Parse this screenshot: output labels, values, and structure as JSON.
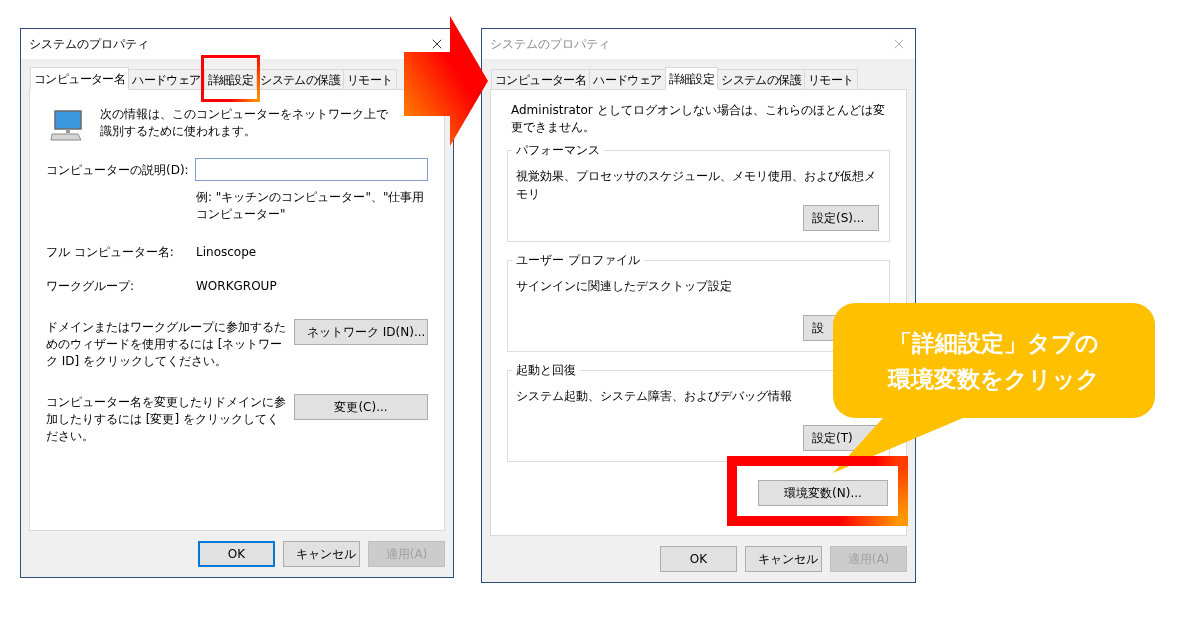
{
  "dialogs": [
    {
      "kind": "computer_name",
      "title": "システムのプロパティ",
      "active": true,
      "tabs": [
        {
          "label": "コンピューター名",
          "selected": true,
          "highlighted": false
        },
        {
          "label": "ハードウェア",
          "selected": false,
          "highlighted": false
        },
        {
          "label": "詳細設定",
          "selected": false,
          "highlighted": true
        },
        {
          "label": "システムの保護",
          "selected": false,
          "highlighted": false
        },
        {
          "label": "リモート",
          "selected": false,
          "highlighted": false
        }
      ],
      "intro": "次の情報は、このコンピューターをネットワーク上で識別するために使われます。",
      "description_label": "コンピューターの説明(D):",
      "example": "例: \"キッチンのコンピューター\"、\"仕事用コンピューター\"",
      "fields": [
        {
          "label": "フル コンピューター名:",
          "value": "Linoscope"
        },
        {
          "label": "ワークグループ:",
          "value": "WORKGROUP"
        }
      ],
      "actions": [
        {
          "text": "ドメインまたはワークグループに参加するためのウィザードを使用するには [ネットワーク ID] をクリックしてください。",
          "button": "ネットワーク ID(N)..."
        },
        {
          "text": "コンピューター名を変更したりドメインに参加したりするには [変更] をクリックしてください。",
          "button": "変更(C)..."
        }
      ],
      "buttons": [
        {
          "label": "OK",
          "focused": true,
          "disabled": false
        },
        {
          "label": "キャンセル",
          "focused": false,
          "disabled": false
        },
        {
          "label": "適用(A)",
          "focused": false,
          "disabled": true
        }
      ]
    },
    {
      "kind": "advanced",
      "title": "システムのプロパティ",
      "active": false,
      "tabs": [
        {
          "label": "コンピューター名",
          "selected": false,
          "highlighted": false
        },
        {
          "label": "ハードウェア",
          "selected": false,
          "highlighted": false
        },
        {
          "label": "詳細設定",
          "selected": true,
          "highlighted": false
        },
        {
          "label": "システムの保護",
          "selected": false,
          "highlighted": false
        },
        {
          "label": "リモート",
          "selected": false,
          "highlighted": false
        }
      ],
      "note": "Administrator としてログオンしない場合は、これらのほとんどは変更できません。",
      "groups": [
        {
          "title": "パフォーマンス",
          "description": "視覚効果、プロセッサのスケジュール、メモリ使用、および仮想メモリ",
          "button": "設定(S)..."
        },
        {
          "title": "ユーザー プロファイル",
          "description": "サインインに関連したデスクトップ設定",
          "button": "設"
        },
        {
          "title": "起動と回復",
          "description": "システム起動、システム障害、およびデバッグ情報",
          "button": "設定(T)"
        }
      ],
      "env_button": {
        "label": "環境変数(N)...",
        "highlighted": true
      },
      "buttons": [
        {
          "label": "OK",
          "focused": false,
          "disabled": false
        },
        {
          "label": "キャンセル",
          "focused": false,
          "disabled": false
        },
        {
          "label": "適用(A)",
          "focused": false,
          "disabled": true
        }
      ]
    }
  ],
  "callout": {
    "lines": [
      "「詳細設定」タブの",
      "環境変数をクリック"
    ]
  }
}
